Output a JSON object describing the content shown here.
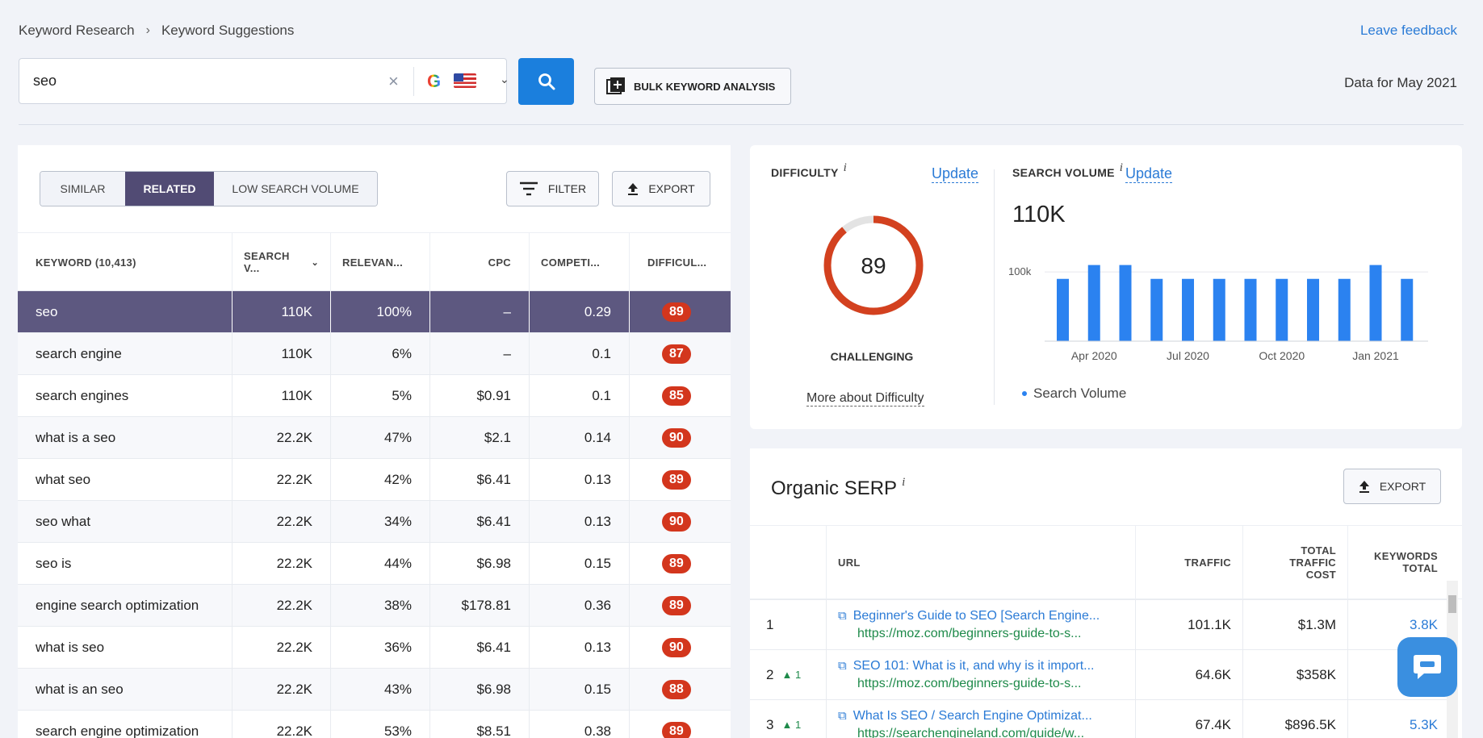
{
  "breadcrumb": {
    "first": "Keyword Research",
    "second": "Keyword Suggestions"
  },
  "feedback": "Leave feedback",
  "search": {
    "value": "seo",
    "clear": "×",
    "engine": "G"
  },
  "bulk_label": "BULK KEYWORD ANALYSIS",
  "data_for": "Data for May 2021",
  "tabs": [
    "SIMILAR",
    "RELATED",
    "LOW SEARCH VOLUME"
  ],
  "active_tab": "RELATED",
  "filter_label": "FILTER",
  "export_label": "EXPORT",
  "table": {
    "headers": [
      "KEYWORD  (10,413)",
      "SEARCH V...",
      "RELEVAN...",
      "CPC",
      "COMPETI...",
      "DIFFICUL..."
    ],
    "rows": [
      [
        "seo",
        "110K",
        "100%",
        "–",
        "0.29",
        "89"
      ],
      [
        "search engine",
        "110K",
        "6%",
        "–",
        "0.1",
        "87"
      ],
      [
        "search engines",
        "110K",
        "5%",
        "$0.91",
        "0.1",
        "85"
      ],
      [
        "what is a seo",
        "22.2K",
        "47%",
        "$2.1",
        "0.14",
        "90"
      ],
      [
        "what seo",
        "22.2K",
        "42%",
        "$6.41",
        "0.13",
        "89"
      ],
      [
        "seo what",
        "22.2K",
        "34%",
        "$6.41",
        "0.13",
        "90"
      ],
      [
        "seo is",
        "22.2K",
        "44%",
        "$6.98",
        "0.15",
        "89"
      ],
      [
        "engine search optimization",
        "22.2K",
        "38%",
        "$178.81",
        "0.36",
        "89"
      ],
      [
        "what is seo",
        "22.2K",
        "36%",
        "$6.41",
        "0.13",
        "90"
      ],
      [
        "what is an seo",
        "22.2K",
        "43%",
        "$6.98",
        "0.15",
        "88"
      ],
      [
        "search engine optimization",
        "22.2K",
        "53%",
        "$8.51",
        "0.38",
        "89"
      ]
    ]
  },
  "difficulty": {
    "label": "DIFFICULTY",
    "info": "i",
    "update": "Update",
    "score": "89",
    "score_value": 89,
    "level": "CHALLENGING",
    "more": "More about Difficulty",
    "color": "#d3411f"
  },
  "volume": {
    "label": "SEARCH VOLUME",
    "info": "i",
    "update": "Update",
    "value": "110K",
    "legend": "Search Volume",
    "chart_data": {
      "type": "bar",
      "ytick": "100k",
      "xticks": [
        "Apr 2020",
        "Jul 2020",
        "Oct 2020",
        "Jan 2021"
      ],
      "values": [
        90000,
        110000,
        110000,
        90000,
        90000,
        90000,
        90000,
        90000,
        90000,
        90000,
        110000,
        90000
      ],
      "color": "#2b82f0"
    }
  },
  "organic": {
    "title": "Organic SERP",
    "info": "i",
    "export": "EXPORT",
    "headers": {
      "url": "URL",
      "traffic": "TRAFFIC",
      "cost": [
        "TOTAL",
        "TRAFFIC",
        "COST"
      ],
      "kw": [
        "KEYWORDS",
        "TOTAL"
      ]
    },
    "rows": [
      {
        "pos": "1",
        "change": "",
        "title": "Beginner's Guide to SEO [Search Engine...",
        "url": "https://moz.com/beginners-guide-to-s...",
        "traffic": "101.1K",
        "cost": "$1.3M",
        "kw": "3.8K"
      },
      {
        "pos": "2",
        "change": "▲ 1",
        "title": "SEO 101: What is it, and why is it import...",
        "url": "https://moz.com/beginners-guide-to-s...",
        "traffic": "64.6K",
        "cost": "$358K",
        "kw": ""
      },
      {
        "pos": "3",
        "change": "▲ 1",
        "title": "What Is SEO / Search Engine Optimizat...",
        "url": "https://searchengineland.com/guide/w...",
        "traffic": "67.4K",
        "cost": "$896.5K",
        "kw": "5.3K"
      }
    ]
  }
}
